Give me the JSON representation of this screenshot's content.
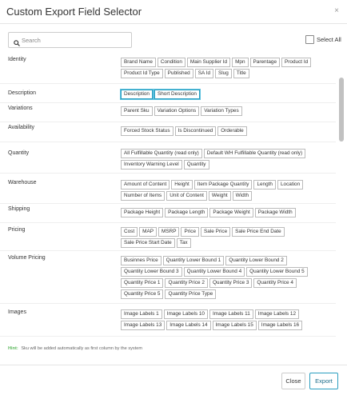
{
  "dialog": {
    "title": "Custom Export Field Selector",
    "close_icon": "×"
  },
  "search": {
    "placeholder": "Search",
    "value": ""
  },
  "select_all": {
    "label": "Select All"
  },
  "sections": [
    {
      "name": "Identity",
      "fields": [
        {
          "label": "Brand Name"
        },
        {
          "label": "Condition"
        },
        {
          "label": "Main Supplier Id"
        },
        {
          "label": "Mpn"
        },
        {
          "label": "Parentage"
        },
        {
          "label": "Product Id"
        },
        {
          "label": "Product Id Type"
        },
        {
          "label": "Published"
        },
        {
          "label": "SA Id"
        },
        {
          "label": "Slug"
        },
        {
          "label": "Title"
        }
      ]
    },
    {
      "name": "Description",
      "fields": [
        {
          "label": "Description",
          "selected": true
        },
        {
          "label": "Short Description",
          "selected": true
        }
      ]
    },
    {
      "name": "Variations",
      "fields": [
        {
          "label": "Parent Sku"
        },
        {
          "label": "Variation Options"
        },
        {
          "label": "Variation Types"
        }
      ]
    },
    {
      "name": "Availability",
      "fields": [
        {
          "label": "Forced Stock Status"
        },
        {
          "label": "Is Discontinued"
        },
        {
          "label": "Orderable"
        }
      ]
    },
    {
      "name": "Quantity",
      "fields": [
        {
          "label": "All Fulfillable Quantity (read only)"
        },
        {
          "label": "Default WH Fulfillable Quantity (read only)"
        },
        {
          "label": "Inventory Warning Level"
        },
        {
          "label": "Quantity"
        }
      ]
    },
    {
      "name": "Warehouse",
      "fields": [
        {
          "label": "Amount of Content"
        },
        {
          "label": "Height"
        },
        {
          "label": "Item Package Quantity"
        },
        {
          "label": "Length"
        },
        {
          "label": "Location"
        },
        {
          "label": "Number of Items"
        },
        {
          "label": "Unit of Content"
        },
        {
          "label": "Weight"
        },
        {
          "label": "Width"
        }
      ]
    },
    {
      "name": "Shipping",
      "fields": [
        {
          "label": "Package Height"
        },
        {
          "label": "Package Length"
        },
        {
          "label": "Package Weight"
        },
        {
          "label": "Package Width"
        }
      ]
    },
    {
      "name": "Pricing",
      "fields": [
        {
          "label": "Cost"
        },
        {
          "label": "MAP"
        },
        {
          "label": "MSRP"
        },
        {
          "label": "Price"
        },
        {
          "label": "Sale Price"
        },
        {
          "label": "Sale Price End Date"
        },
        {
          "label": "Sale Price Start Date"
        },
        {
          "label": "Tax"
        }
      ]
    },
    {
      "name": "Volume Pricing",
      "fields": [
        {
          "label": "Businnes Price"
        },
        {
          "label": "Quantity Lower Bound 1"
        },
        {
          "label": "Quantity Lower Bound 2"
        },
        {
          "label": "Quantity Lower Bound 3"
        },
        {
          "label": "Quantity Lower Bound 4"
        },
        {
          "label": "Quantity Lower Bound 5"
        },
        {
          "label": "Quantity Price 1"
        },
        {
          "label": "Quantity Price 2"
        },
        {
          "label": "Quantity Price 3"
        },
        {
          "label": "Quantity Price 4"
        },
        {
          "label": "Quantity Price 5"
        },
        {
          "label": "Quantity Price Type"
        }
      ]
    },
    {
      "name": "Images",
      "fields": [
        {
          "label": "Image Labels 1"
        },
        {
          "label": "Image Labels 10"
        },
        {
          "label": "Image Labels 11"
        },
        {
          "label": "Image Labels 12"
        },
        {
          "label": "Image Labels 13"
        },
        {
          "label": "Image Labels 14"
        },
        {
          "label": "Image Labels 15"
        },
        {
          "label": "Image Labels 16"
        }
      ]
    }
  ],
  "hint": {
    "label": "Hint:",
    "text": "Sku will be added automatically as first column by the system"
  },
  "footer": {
    "close_label": "Close",
    "export_label": "Export"
  },
  "colors": {
    "accent": "#2a9ec0",
    "hint": "#5cb85c"
  }
}
